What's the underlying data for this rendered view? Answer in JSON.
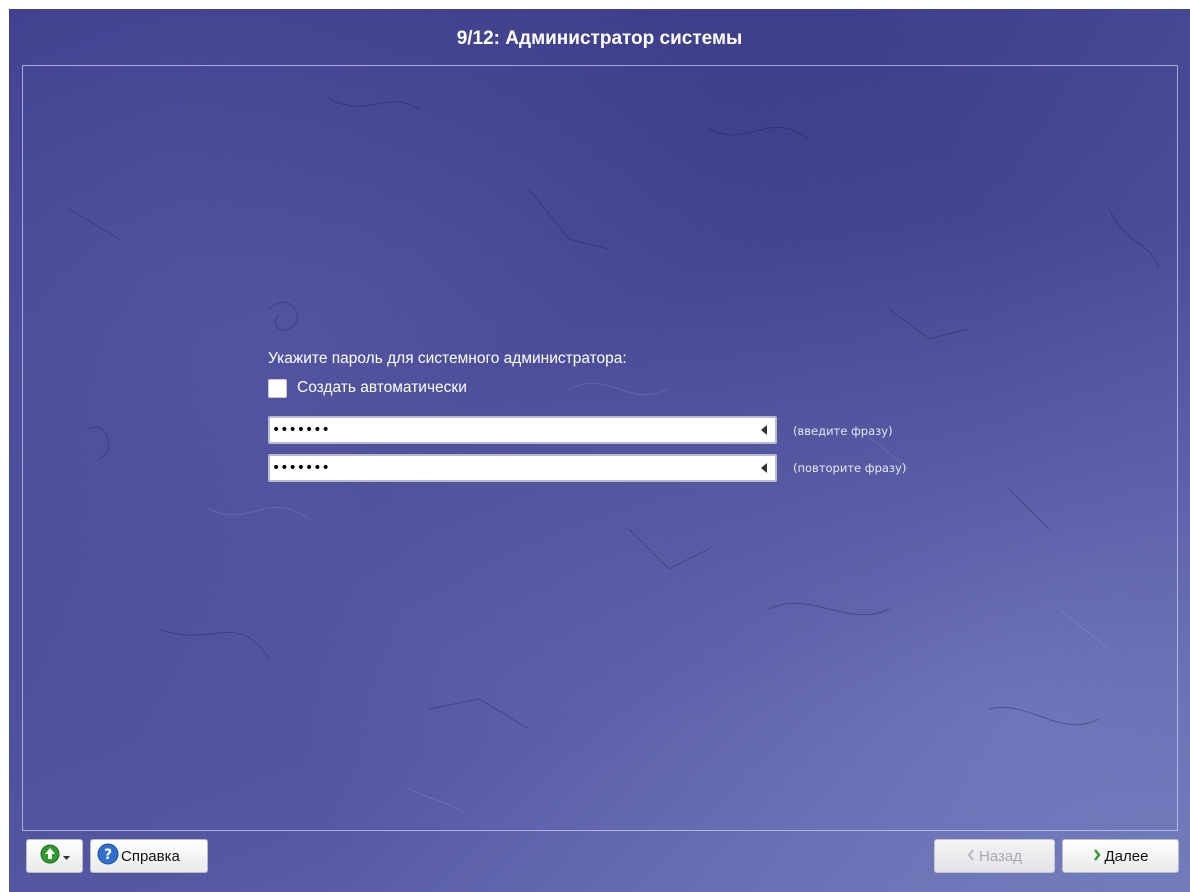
{
  "window": {
    "title": "9/12: Администратор системы"
  },
  "form": {
    "prompt": "Укажите пароль для системного администратора:",
    "auto_generate_label": "Создать автоматически",
    "auto_generate_checked": false,
    "password_value": "•••••••",
    "password_hint": "(введите фразу)",
    "confirm_value": "•••••••",
    "confirm_hint": "(повторите фразу)"
  },
  "footer": {
    "language_icon": "green-up-arrow-icon",
    "help_label": "Справка",
    "help_icon": "question-icon",
    "back_label": "Назад",
    "back_enabled": false,
    "next_label": "Далее"
  },
  "colors": {
    "background": "#4a4b97",
    "text": "#ffffff",
    "accent_green": "#2f9b2f",
    "help_blue": "#2f6fd0"
  }
}
